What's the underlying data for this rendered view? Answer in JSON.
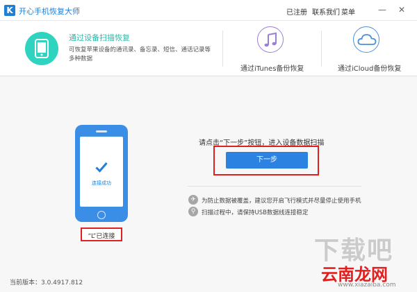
{
  "titlebar": {
    "logo": "K",
    "title": "开心手机恢复大师",
    "menu": [
      "已注册",
      "联系我们",
      "菜单"
    ],
    "minimize": "—",
    "close": "✕"
  },
  "modes": {
    "device": {
      "title": "通过设备扫描恢复",
      "desc": "可恢复苹果设备的通讯录、备忘录、短信、通话记录等多种数据",
      "icon": "phone-icon"
    },
    "itunes": {
      "label": "通过iTunes备份恢复",
      "icon": "music-note-icon"
    },
    "icloud": {
      "label": "通过iCloud备份恢复",
      "icon": "cloud-icon"
    }
  },
  "device": {
    "status": "连接成功",
    "name": "“L”已连接"
  },
  "main": {
    "instruction": "请点击“下一步”按钮，进入设备数据扫描",
    "next_label": "下一步",
    "tips": [
      "为防止数据被覆盖，建议您开启飞行模式并尽量停止使用手机",
      "扫描过程中，请保持USB数据线连接稳定"
    ]
  },
  "footer": {
    "version": "当前版本：3.0.4917.812"
  },
  "watermark": {
    "big": "下载吧",
    "brand": "云南龙网",
    "url": "www.xiazaiba.com"
  },
  "colors": {
    "accent": "#1e7fd6",
    "teal": "#2fd4c0",
    "highlight": "#e02020"
  }
}
